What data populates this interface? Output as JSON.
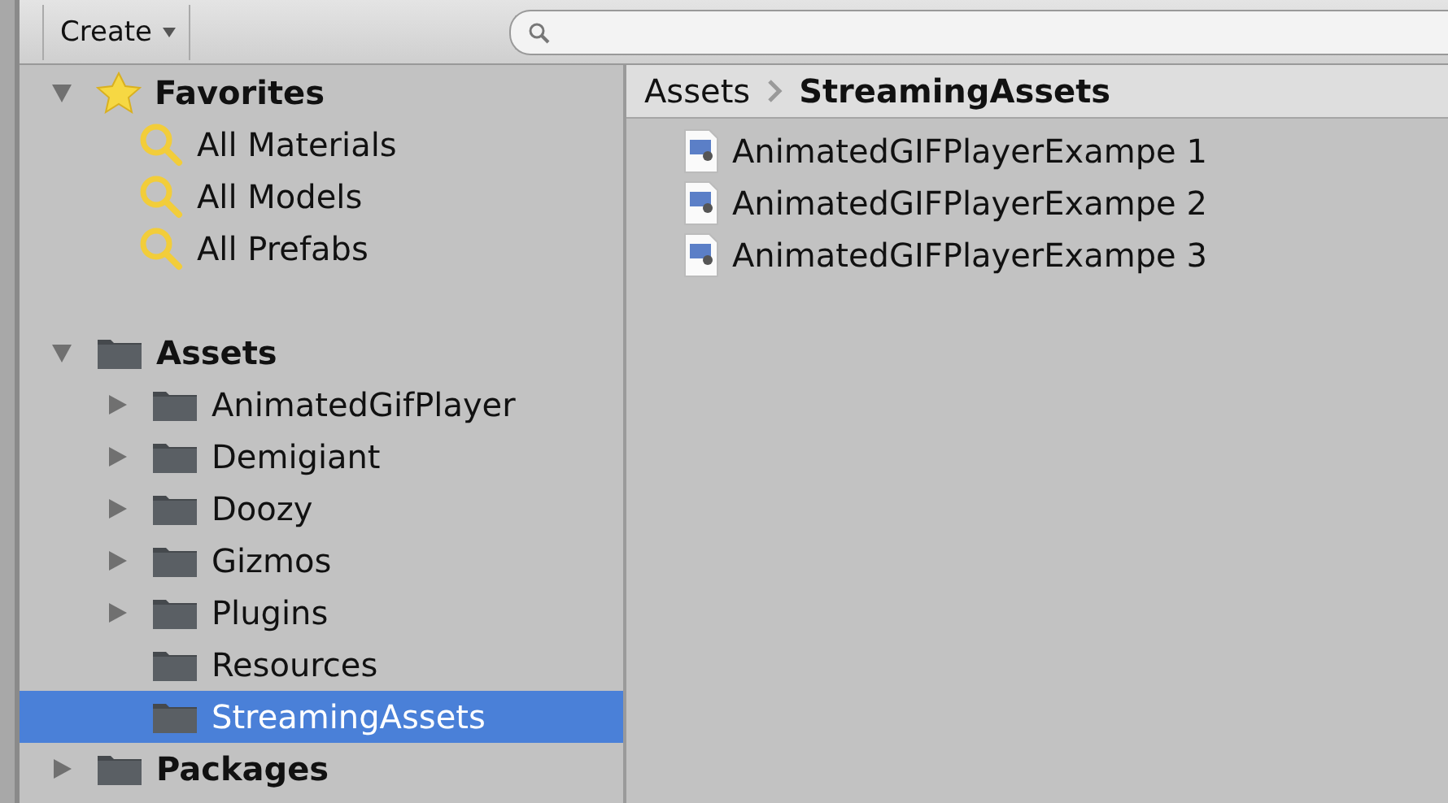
{
  "toolbar": {
    "create_button": "Create"
  },
  "favorites": {
    "label": "Favorites",
    "expanded": true,
    "children": [
      {
        "label": "All Materials"
      },
      {
        "label": "All Models"
      },
      {
        "label": "All Prefabs"
      }
    ]
  },
  "assets": {
    "label": "Assets",
    "expanded": true,
    "children": [
      {
        "label": "AnimatedGifPlayer",
        "expandable": true,
        "selected": false
      },
      {
        "label": "Demigiant",
        "expandable": true,
        "selected": false
      },
      {
        "label": "Doozy",
        "expandable": true,
        "selected": false
      },
      {
        "label": "Gizmos",
        "expandable": true,
        "selected": false
      },
      {
        "label": "Plugins",
        "expandable": true,
        "selected": false
      },
      {
        "label": "Resources",
        "expandable": false,
        "selected": false
      },
      {
        "label": "StreamingAssets",
        "expandable": false,
        "selected": true
      }
    ]
  },
  "packages": {
    "label": "Packages",
    "expanded": false
  },
  "breadcrumb": [
    "Assets",
    "StreamingAssets"
  ],
  "files": [
    {
      "name": "AnimatedGIFPlayerExampe 1"
    },
    {
      "name": "AnimatedGIFPlayerExampe 2"
    },
    {
      "name": "AnimatedGIFPlayerExampe 3"
    }
  ]
}
